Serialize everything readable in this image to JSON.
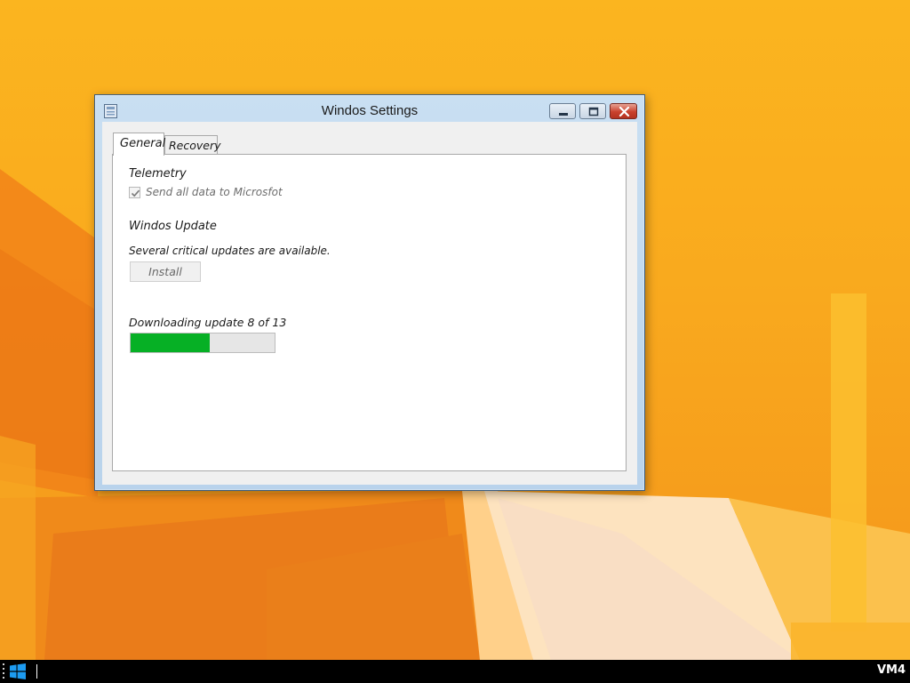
{
  "window": {
    "title": "Windos Settings",
    "icon": "settings-app-icon",
    "controls": [
      "minimize-icon",
      "maximize-icon",
      "close-icon"
    ]
  },
  "tabs": [
    {
      "label": "General",
      "selected": true
    },
    {
      "label": "Recovery",
      "selected": false
    }
  ],
  "telemetry": {
    "heading": "Telemetry",
    "checkbox_label": "Send all data to Microsfot",
    "checked": true,
    "disabled": true
  },
  "update": {
    "heading": "Windos Update",
    "status": "Several critical updates are available.",
    "install_label": "Install",
    "install_disabled": true
  },
  "download": {
    "status": "Downloading update 8 of 13",
    "progress_fraction": 0.55
  },
  "taskbar": {
    "start_icon": "windows-logo-icon",
    "vm_label": "VM4"
  },
  "colors": {
    "wallpaper": "#f9a91e",
    "progress_fill": "#06b025",
    "close_button": "#c9412d"
  }
}
